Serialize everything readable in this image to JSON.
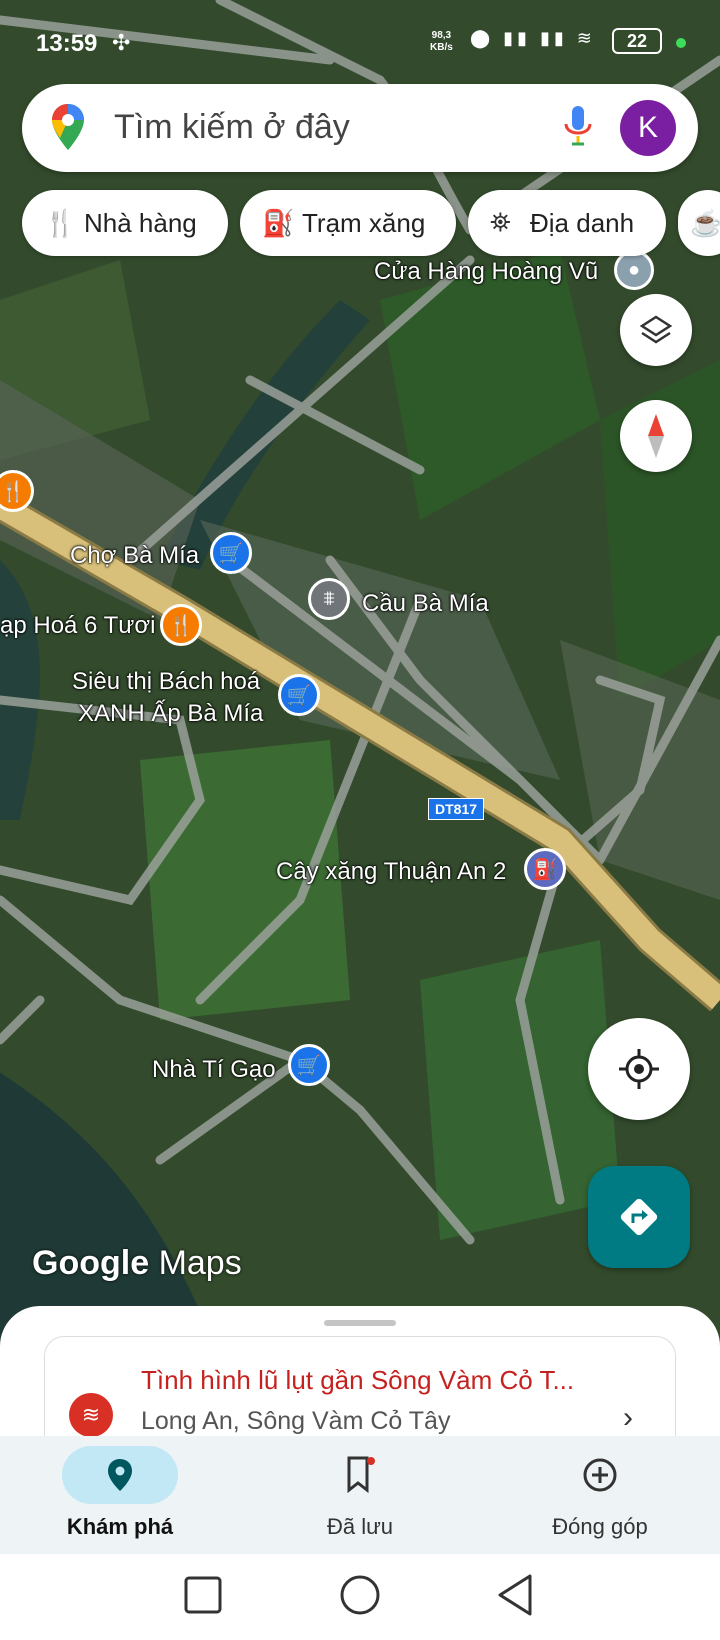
{
  "status_bar": {
    "time": "13:59",
    "speed_value": "98,3",
    "speed_unit": "KB/s",
    "battery": "22"
  },
  "search": {
    "placeholder": "Tìm kiếm ở đây",
    "avatar_letter": "K"
  },
  "chips": [
    {
      "label": "Nhà hàng",
      "icon": "restaurant-icon"
    },
    {
      "label": "Trạm xăng",
      "icon": "gas-station-icon"
    },
    {
      "label": "Địa danh",
      "icon": "landmark-icon"
    }
  ],
  "map": {
    "labels": {
      "store_hoang_vu": "Cửa Hàng Hoàng Vũ",
      "cho_ba_mia": "Chợ Bà Mía",
      "cau_ba_mia": "Cầu Bà Mía",
      "tap_hoa": "ạp Hoá 6 Tươi",
      "sieuthi_line1": "Siêu thị Bách hoá",
      "sieuthi_line2": "XANH Ấp Bà Mía",
      "cay_xang": "Cây xăng Thuận An 2",
      "nha_ti_gao": "Nhà Tí Gạo",
      "route": "DT817"
    },
    "watermark_1": "Google",
    "watermark_2": "Maps"
  },
  "alert": {
    "title": "Tình hình lũ lụt gần Sông Vàm Cỏ T...",
    "subtitle": "Long An, Sông Vàm Cỏ Tây"
  },
  "nav": {
    "explore": "Khám phá",
    "saved": "Đã lưu",
    "contribute": "Đóng góp"
  },
  "colors": {
    "road_main": "#d8c07a",
    "accent_blue": "#1a73e8",
    "directions_teal": "#007b83",
    "alert_red": "#c5221f"
  }
}
